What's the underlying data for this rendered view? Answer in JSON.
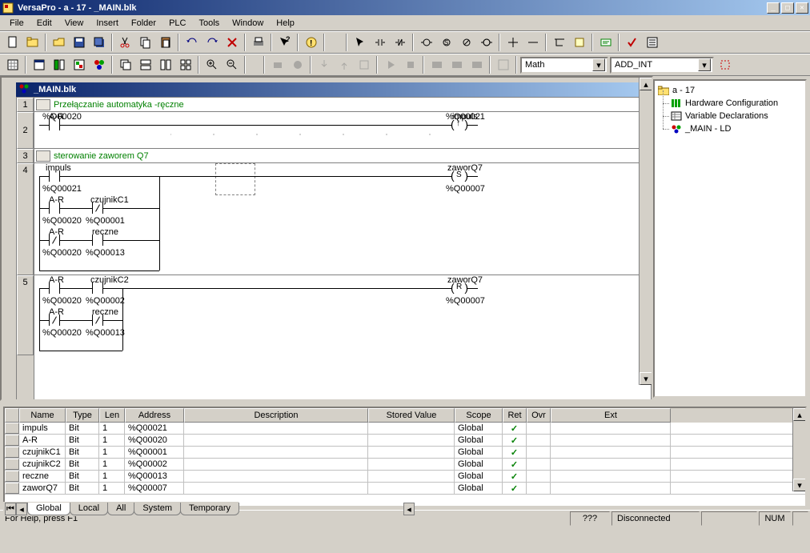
{
  "window": {
    "title": "VersaPro - a - 17 - _MAIN.blk"
  },
  "menu": {
    "items": [
      "File",
      "Edit",
      "View",
      "Insert",
      "Folder",
      "PLC",
      "Tools",
      "Window",
      "Help"
    ]
  },
  "toolbar2": {
    "combo1": "Math",
    "combo2": "ADD_INT"
  },
  "child": {
    "title": "_MAIN.blk"
  },
  "tree": {
    "root": "a - 17",
    "items": [
      {
        "label": "Hardware Configuration",
        "icon": "hwconfig"
      },
      {
        "label": "Variable Declarations",
        "icon": "vardecl"
      },
      {
        "label": "_MAIN - LD",
        "icon": "main"
      }
    ]
  },
  "ladder": {
    "row1_comment": "Przełączanie automatyka -ręczne",
    "row3_comment": "sterowanie zaworem Q7",
    "row2": {
      "top_left": "A-R",
      "top_right": "impuls",
      "bot_left": "%Q00020",
      "bot_right": "%Q00021",
      "coil_mark": "↑"
    },
    "row4": {
      "lbl_impuls": "impuls",
      "lbl_zaworQ7": "zaworQ7",
      "coil_mark": "S",
      "addr_q21": "%Q00021",
      "addr_q7": "%Q00007",
      "lbl_AR": "A-R",
      "lbl_cz1": "czujnikC1",
      "addr_q20_a": "%Q00020",
      "addr_q1": "%Q00001",
      "lbl_rec": "reczne",
      "addr_q20_b": "%Q00020",
      "addr_q13": "%Q00013"
    },
    "row5": {
      "lbl_AR": "A-R",
      "lbl_cz2": "czujnikC2",
      "addr_q20": "%Q00020",
      "addr_q2": "%Q00002",
      "lbl_rec": "reczne",
      "addr_q20b": "%Q00020",
      "addr_q13": "%Q00013",
      "lbl_zaworQ7": "zaworQ7",
      "coil_mark": "R",
      "addr_q7": "%Q00007"
    }
  },
  "grid": {
    "columns": [
      "Name",
      "Type",
      "Len",
      "Address",
      "Description",
      "Stored Value",
      "Scope",
      "Ret",
      "Ovr",
      "Ext"
    ],
    "rows": [
      {
        "name": "impuls",
        "type": "Bit",
        "len": "1",
        "addr": "%Q00021",
        "desc": "",
        "stored": "",
        "scope": "Global",
        "ret": "✓",
        "ovr": "",
        "ext": ""
      },
      {
        "name": "A-R",
        "type": "Bit",
        "len": "1",
        "addr": "%Q00020",
        "desc": "",
        "stored": "",
        "scope": "Global",
        "ret": "✓",
        "ovr": "",
        "ext": ""
      },
      {
        "name": "czujnikC1",
        "type": "Bit",
        "len": "1",
        "addr": "%Q00001",
        "desc": "",
        "stored": "",
        "scope": "Global",
        "ret": "✓",
        "ovr": "",
        "ext": ""
      },
      {
        "name": "czujnikC2",
        "type": "Bit",
        "len": "1",
        "addr": "%Q00002",
        "desc": "",
        "stored": "",
        "scope": "Global",
        "ret": "✓",
        "ovr": "",
        "ext": ""
      },
      {
        "name": "reczne",
        "type": "Bit",
        "len": "1",
        "addr": "%Q00013",
        "desc": "",
        "stored": "",
        "scope": "Global",
        "ret": "✓",
        "ovr": "",
        "ext": ""
      },
      {
        "name": "zaworQ7",
        "type": "Bit",
        "len": "1",
        "addr": "%Q00007",
        "desc": "",
        "stored": "",
        "scope": "Global",
        "ret": "✓",
        "ovr": "",
        "ext": ""
      }
    ],
    "tabs": [
      "Global",
      "Local",
      "All",
      "System",
      "Temporary"
    ],
    "active_tab": 0
  },
  "status": {
    "help": "For Help, press F1",
    "cell1": "???",
    "cell2": "Disconnected",
    "cell3": "",
    "cell4": "NUM",
    "cell5": ""
  },
  "colwidths": {
    "rowhead": 18,
    "name": 58,
    "type": 42,
    "len": 32,
    "addr": 74,
    "desc": 230,
    "stored": 108,
    "scope": 60,
    "ret": 30,
    "ovr": 30,
    "ext": 150
  },
  "chart_data": null
}
